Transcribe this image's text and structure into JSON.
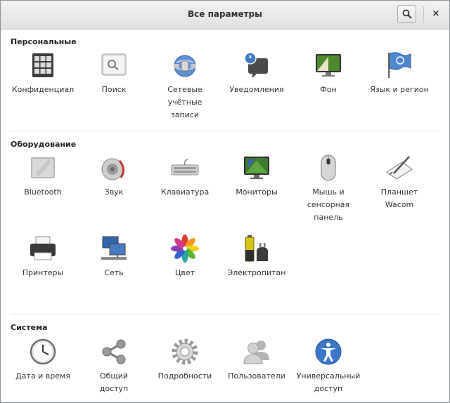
{
  "window": {
    "title": "Все параметры"
  },
  "header": {
    "search_icon": "search-icon",
    "close_glyph": "×"
  },
  "sections": {
    "personal": {
      "title": "Персональные",
      "items": [
        {
          "label": "Конфиденциал",
          "icon": "privacy-icon"
        },
        {
          "label": "Поиск",
          "icon": "search-settings-icon"
        },
        {
          "label": "Сетевые\nучётные\nзаписи",
          "icon": "online-accounts-icon"
        },
        {
          "label": "Уведомления",
          "icon": "notifications-icon"
        },
        {
          "label": "Фон",
          "icon": "background-icon"
        },
        {
          "label": "Язык и регион",
          "icon": "region-flag-icon"
        }
      ]
    },
    "hardware": {
      "title": "Оборудование",
      "items": [
        {
          "label": "Bluetooth",
          "icon": "bluetooth-icon"
        },
        {
          "label": "Звук",
          "icon": "sound-icon"
        },
        {
          "label": "Клавиатура",
          "icon": "keyboard-icon"
        },
        {
          "label": "Мониторы",
          "icon": "display-icon"
        },
        {
          "label": "Мышь и\nсенсорная\nпанель",
          "icon": "mouse-icon"
        },
        {
          "label": "Планшет\nWacom",
          "icon": "tablet-icon"
        },
        {
          "label": "Принтеры",
          "icon": "printer-icon"
        },
        {
          "label": "Сеть",
          "icon": "network-icon"
        },
        {
          "label": "Цвет",
          "icon": "color-icon"
        },
        {
          "label": "Электропитан",
          "icon": "power-icon"
        }
      ]
    },
    "system": {
      "title": "Система",
      "items": [
        {
          "label": "Дата и время",
          "icon": "clock-icon"
        },
        {
          "label": "Общий\nдоступ",
          "icon": "sharing-icon"
        },
        {
          "label": "Подробности",
          "icon": "details-gear-icon"
        },
        {
          "label": "Пользователи",
          "icon": "users-icon"
        },
        {
          "label": "Универсальный\nдоступ",
          "icon": "accessibility-icon"
        }
      ]
    }
  }
}
